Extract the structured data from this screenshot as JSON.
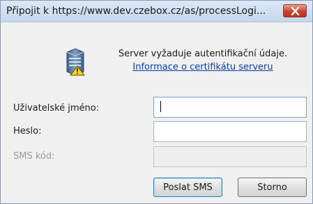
{
  "window": {
    "title": "Připojit k https://www.dev.czebox.cz/as/processLogi..."
  },
  "message": {
    "text": "Server vyžaduje autentifikační údaje.",
    "link": "Informace o certifikátu serveru"
  },
  "form": {
    "username": {
      "label": "Uživatelské jméno:",
      "value": ""
    },
    "password": {
      "label": "Heslo:",
      "value": ""
    },
    "sms": {
      "label": "SMS kód:",
      "value": "",
      "disabled": true
    }
  },
  "buttons": {
    "send_sms": "Poslat SMS",
    "cancel": "Storno"
  },
  "colors": {
    "link": "#0a3da6",
    "close_button": "#c9452f",
    "titlebar": "#c5d8ee"
  },
  "icons": {
    "close": "close-icon",
    "server_warning": "server-warning-icon"
  }
}
